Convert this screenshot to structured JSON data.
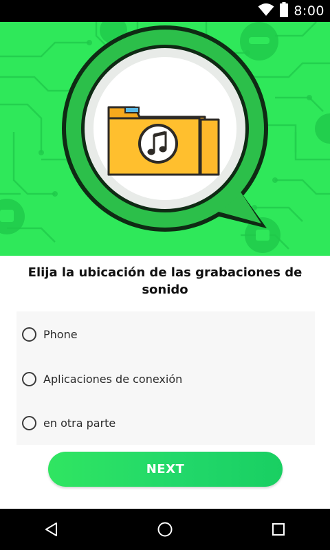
{
  "status_bar": {
    "time": "8:00",
    "icons": [
      "wifi-icon",
      "battery-icon"
    ]
  },
  "hero": {
    "background_color": "#2fe85a",
    "illustration": "folder-music-icon"
  },
  "question": "Elija la ubicación de las grabaciones de sonido",
  "options": [
    {
      "label": "Phone",
      "selected": false
    },
    {
      "label": "Aplicaciones de conexión",
      "selected": false
    },
    {
      "label": "en otra parte",
      "selected": false
    }
  ],
  "next_button": {
    "label": "NEXT",
    "color": "#22d86a"
  },
  "nav_bar": {
    "buttons": [
      "back-icon",
      "home-icon",
      "recents-icon"
    ]
  }
}
